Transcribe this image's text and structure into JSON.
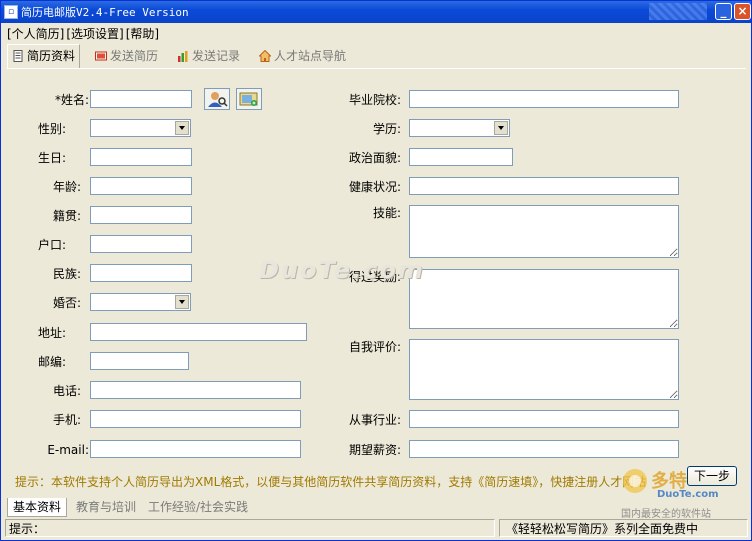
{
  "window": {
    "title": "简历电邮版V2.4-Free Version",
    "min_symbol": "_",
    "close_symbol": "×"
  },
  "menu": [
    "[个人简历]",
    "[选项设置]",
    "[帮助]"
  ],
  "tabs": [
    {
      "label": "简历资料",
      "icon": "document-icon",
      "active": true
    },
    {
      "label": "发送简历",
      "icon": "send-icon",
      "active": false
    },
    {
      "label": "发送记录",
      "icon": "chart-icon",
      "active": false
    },
    {
      "label": "人才站点导航",
      "icon": "home-icon",
      "active": false
    }
  ],
  "form_left": {
    "name": {
      "label": "*姓名:",
      "value": ""
    },
    "gender": {
      "label": "性别:",
      "value": ""
    },
    "birthday": {
      "label": "生日:",
      "value": ""
    },
    "age": {
      "label": "年龄:",
      "value": ""
    },
    "native_place": {
      "label": "籍贯:",
      "value": ""
    },
    "hukou": {
      "label": "户口:",
      "value": ""
    },
    "ethnicity": {
      "label": "民族:",
      "value": ""
    },
    "marital": {
      "label": "婚否:",
      "value": ""
    },
    "address": {
      "label": "地址:",
      "value": ""
    },
    "postcode": {
      "label": "邮编:",
      "value": ""
    },
    "phone": {
      "label": "电话:",
      "value": ""
    },
    "mobile": {
      "label": "手机:",
      "value": ""
    },
    "email": {
      "label": "E-mail:",
      "value": ""
    }
  },
  "form_right": {
    "school": {
      "label": "毕业院校:",
      "value": ""
    },
    "education": {
      "label": "学历:",
      "value": ""
    },
    "political": {
      "label": "政治面貌:",
      "value": ""
    },
    "health": {
      "label": "健康状况:",
      "value": ""
    },
    "skills": {
      "label": "技能:",
      "value": ""
    },
    "awards": {
      "label": "得过奖励:",
      "value": ""
    },
    "self_eval": {
      "label": "自我评价:",
      "value": ""
    },
    "industry": {
      "label": "从事行业:",
      "value": ""
    },
    "salary": {
      "label": "期望薪资:",
      "value": ""
    }
  },
  "watermark": "DuoTe.com",
  "hint": "提示：本软件支持个人简历导出为XML格式，以便与其他简历软件共享简历资料，支持《简历速填》，快捷注册人才网站",
  "next_button": "下一步",
  "bottom_tabs": [
    {
      "label": "基本资料",
      "active": true
    },
    {
      "label": "教育与培训",
      "active": false
    },
    {
      "label": "工作经验/社会实践",
      "active": false
    }
  ],
  "status": {
    "left": "提示：",
    "right": "《轻轻松松写简历》系列全面免费中"
  },
  "logo": {
    "text1": "多特",
    "text2": "DuoTe.com",
    "text3": "国内最安全的软件站"
  },
  "colors": {
    "titlebar": "#0a43c9",
    "hint": "#a07a00",
    "input_border": "#7f9db9"
  }
}
